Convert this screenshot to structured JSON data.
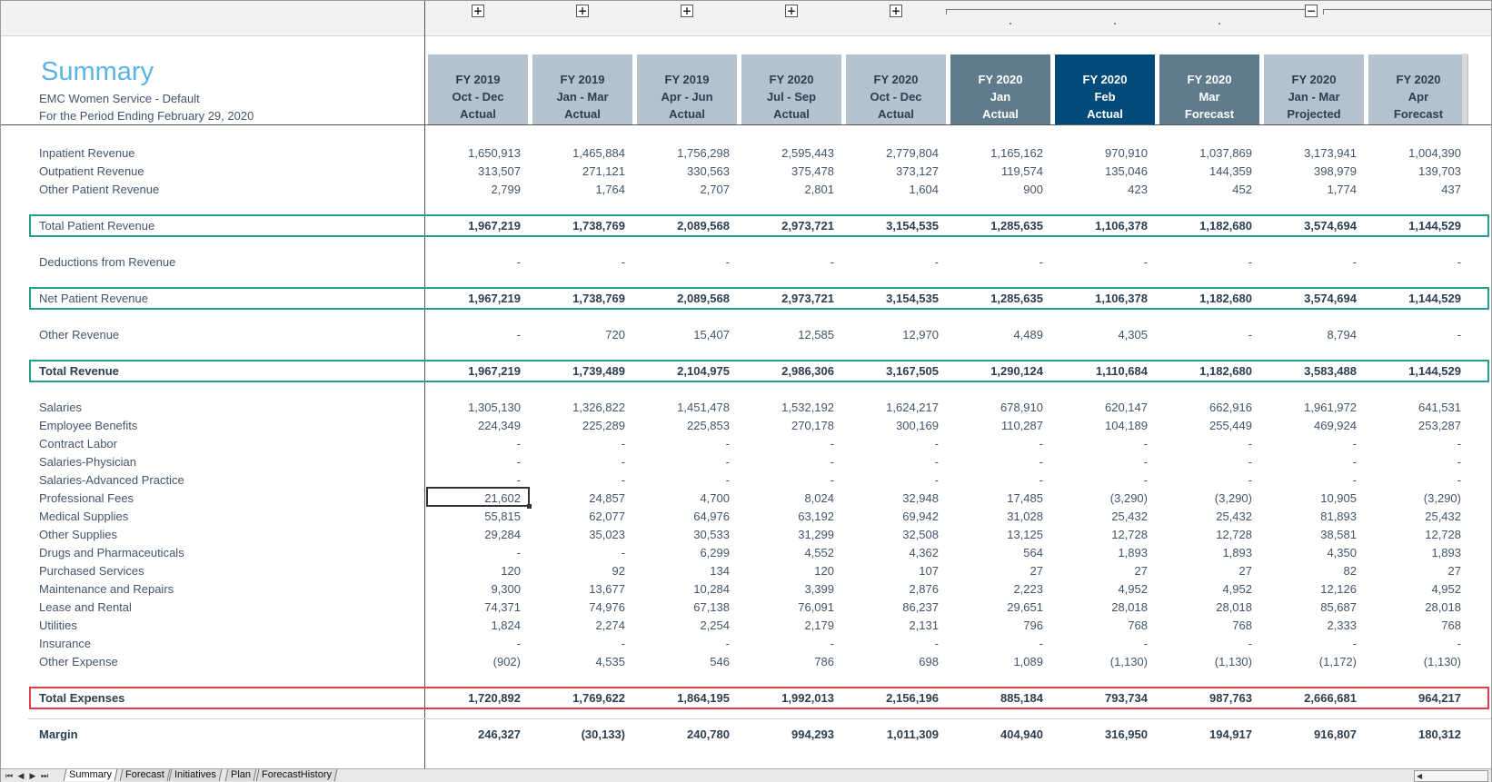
{
  "header": {
    "title": "Summary",
    "entity": "EMC Women Service - Default",
    "period": "For the Period Ending February 29, 2020"
  },
  "group_buttons": [
    "+",
    "+",
    "+",
    "+",
    "+",
    "−"
  ],
  "columns": [
    {
      "l1": "FY 2019",
      "l2": "Oct - Dec",
      "l3": "Actual",
      "bg": "#b4c2cd",
      "fg": "#2c3e50"
    },
    {
      "l1": "FY 2019",
      "l2": "Jan - Mar",
      "l3": "Actual",
      "bg": "#b4c2cd",
      "fg": "#2c3e50"
    },
    {
      "l1": "FY 2019",
      "l2": "Apr - Jun",
      "l3": "Actual",
      "bg": "#b4c2cd",
      "fg": "#2c3e50"
    },
    {
      "l1": "FY 2020",
      "l2": "Jul - Sep",
      "l3": "Actual",
      "bg": "#b4c2cd",
      "fg": "#2c3e50"
    },
    {
      "l1": "FY 2020",
      "l2": "Oct - Dec",
      "l3": "Actual",
      "bg": "#b4c2cd",
      "fg": "#2c3e50"
    },
    {
      "l1": "FY 2020",
      "l2": "Jan",
      "l3": "Actual",
      "bg": "#5f7b8c",
      "fg": "#ffffff"
    },
    {
      "l1": "FY 2020",
      "l2": "Feb",
      "l3": "Actual",
      "bg": "#004b7a",
      "fg": "#ffffff"
    },
    {
      "l1": "FY 2020",
      "l2": "Mar",
      "l3": "Forecast",
      "bg": "#5f7b8c",
      "fg": "#ffffff"
    },
    {
      "l1": "FY 2020",
      "l2": "Jan - Mar",
      "l3": "Projected",
      "bg": "#b4c2cd",
      "fg": "#2c3e50"
    },
    {
      "l1": "FY 2020",
      "l2": "Apr",
      "l3": "Forecast",
      "bg": "#b4c2cd",
      "fg": "#2c3e50"
    }
  ],
  "rows": [
    {
      "label": "Inpatient Revenue",
      "values": [
        "1,650,913",
        "1,465,884",
        "1,756,298",
        "2,595,443",
        "2,779,804",
        "1,165,162",
        "970,910",
        "1,037,869",
        "3,173,941",
        "1,004,390"
      ]
    },
    {
      "label": "Outpatient Revenue",
      "values": [
        "313,507",
        "271,121",
        "330,563",
        "375,478",
        "373,127",
        "119,574",
        "135,046",
        "144,359",
        "398,979",
        "139,703"
      ]
    },
    {
      "label": "Other Patient Revenue",
      "values": [
        "2,799",
        "1,764",
        "2,707",
        "2,801",
        "1,604",
        "900",
        "423",
        "452",
        "1,774",
        "437"
      ]
    },
    {
      "label": "Total Patient Revenue",
      "values": [
        "1,967,219",
        "1,738,769",
        "2,089,568",
        "2,973,721",
        "3,154,535",
        "1,285,635",
        "1,106,378",
        "1,182,680",
        "3,574,694",
        "1,144,529"
      ],
      "bold_values": true,
      "highlight": "green"
    },
    {
      "label": "Deductions from Revenue",
      "values": [
        "-",
        "-",
        "-",
        "-",
        "-",
        "-",
        "-",
        "-",
        "-",
        "-"
      ]
    },
    {
      "label": "Net Patient Revenue",
      "values": [
        "1,967,219",
        "1,738,769",
        "2,089,568",
        "2,973,721",
        "3,154,535",
        "1,285,635",
        "1,106,378",
        "1,182,680",
        "3,574,694",
        "1,144,529"
      ],
      "bold_values": true,
      "highlight": "green"
    },
    {
      "label": "Other Revenue",
      "values": [
        "-",
        "720",
        "15,407",
        "12,585",
        "12,970",
        "4,489",
        "4,305",
        "-",
        "8,794",
        "-"
      ]
    },
    {
      "label": "Total Revenue",
      "values": [
        "1,967,219",
        "1,739,489",
        "2,104,975",
        "2,986,306",
        "3,167,505",
        "1,290,124",
        "1,110,684",
        "1,182,680",
        "3,583,488",
        "1,144,529"
      ],
      "bold_values": true,
      "bold_label": true,
      "highlight": "green"
    },
    {
      "label": "Salaries",
      "values": [
        "1,305,130",
        "1,326,822",
        "1,451,478",
        "1,532,192",
        "1,624,217",
        "678,910",
        "620,147",
        "662,916",
        "1,961,972",
        "641,531"
      ]
    },
    {
      "label": "Employee Benefits",
      "values": [
        "224,349",
        "225,289",
        "225,853",
        "270,178",
        "300,169",
        "110,287",
        "104,189",
        "255,449",
        "469,924",
        "253,287"
      ]
    },
    {
      "label": "Contract Labor",
      "values": [
        "-",
        "-",
        "-",
        "-",
        "-",
        "-",
        "-",
        "-",
        "-",
        "-"
      ]
    },
    {
      "label": "Salaries-Physician",
      "values": [
        "-",
        "-",
        "-",
        "-",
        "-",
        "-",
        "-",
        "-",
        "-",
        "-"
      ]
    },
    {
      "label": "Salaries-Advanced Practice",
      "values": [
        "-",
        "-",
        "-",
        "-",
        "-",
        "-",
        "-",
        "-",
        "-",
        "-"
      ]
    },
    {
      "label": "Professional Fees",
      "values": [
        "21,602",
        "24,857",
        "4,700",
        "8,024",
        "32,948",
        "17,485",
        "(3,290)",
        "(3,290)",
        "10,905",
        "(3,290)"
      ]
    },
    {
      "label": "Medical Supplies",
      "values": [
        "55,815",
        "62,077",
        "64,976",
        "63,192",
        "69,942",
        "31,028",
        "25,432",
        "25,432",
        "81,893",
        "25,432"
      ]
    },
    {
      "label": "Other Supplies",
      "values": [
        "29,284",
        "35,023",
        "30,533",
        "31,299",
        "32,508",
        "13,125",
        "12,728",
        "12,728",
        "38,581",
        "12,728"
      ]
    },
    {
      "label": "Drugs and Pharmaceuticals",
      "values": [
        "-",
        "-",
        "6,299",
        "4,552",
        "4,362",
        "564",
        "1,893",
        "1,893",
        "4,350",
        "1,893"
      ]
    },
    {
      "label": "Purchased Services",
      "values": [
        "120",
        "92",
        "134",
        "120",
        "107",
        "27",
        "27",
        "27",
        "82",
        "27"
      ]
    },
    {
      "label": "Maintenance and Repairs",
      "values": [
        "9,300",
        "13,677",
        "10,284",
        "3,399",
        "2,876",
        "2,223",
        "4,952",
        "4,952",
        "12,126",
        "4,952"
      ]
    },
    {
      "label": "Lease and Rental",
      "values": [
        "74,371",
        "74,976",
        "67,138",
        "76,091",
        "86,237",
        "29,651",
        "28,018",
        "28,018",
        "85,687",
        "28,018"
      ]
    },
    {
      "label": "Utilities",
      "values": [
        "1,824",
        "2,274",
        "2,254",
        "2,179",
        "2,131",
        "796",
        "768",
        "768",
        "2,333",
        "768"
      ]
    },
    {
      "label": "Insurance",
      "values": [
        "-",
        "-",
        "-",
        "-",
        "-",
        "-",
        "-",
        "-",
        "-",
        "-"
      ]
    },
    {
      "label": "Other Expense",
      "values": [
        "(902)",
        "4,535",
        "546",
        "786",
        "698",
        "1,089",
        "(1,130)",
        "(1,130)",
        "(1,172)",
        "(1,130)"
      ]
    },
    {
      "label": "Total Expenses",
      "values": [
        "1,720,892",
        "1,769,622",
        "1,864,195",
        "1,992,013",
        "2,156,196",
        "885,184",
        "793,734",
        "987,763",
        "2,666,681",
        "964,217"
      ],
      "bold_values": true,
      "bold_label": true,
      "highlight": "red"
    },
    {
      "label": "Margin",
      "values": [
        "246,327",
        "(30,133)",
        "240,780",
        "994,293",
        "1,011,309",
        "404,940",
        "316,950",
        "194,917",
        "916,807",
        "180,312"
      ],
      "bold_values": true,
      "bold_label": true
    }
  ],
  "selected_cell": {
    "row": "Professional Fees",
    "column": 0
  },
  "sheet_tabs": [
    {
      "name": "Summary",
      "active": true
    },
    {
      "name": "Forecast",
      "active": false
    },
    {
      "name": "Initiatives",
      "active": false
    },
    {
      "name": "Plan",
      "active": false
    },
    {
      "name": "ForecastHistory",
      "active": false
    }
  ],
  "nav_buttons": [
    "⏮",
    "◀",
    "▶",
    "⏭"
  ],
  "scroll_arrow": "◀",
  "colors": {
    "title": "#5ab4e8",
    "header_light": "#b4c2cd",
    "header_dark": "#5f7b8c",
    "header_selected": "#004b7a",
    "highlight_green": "#1fa08a",
    "highlight_red": "#e0404a",
    "text": "#44546a"
  }
}
